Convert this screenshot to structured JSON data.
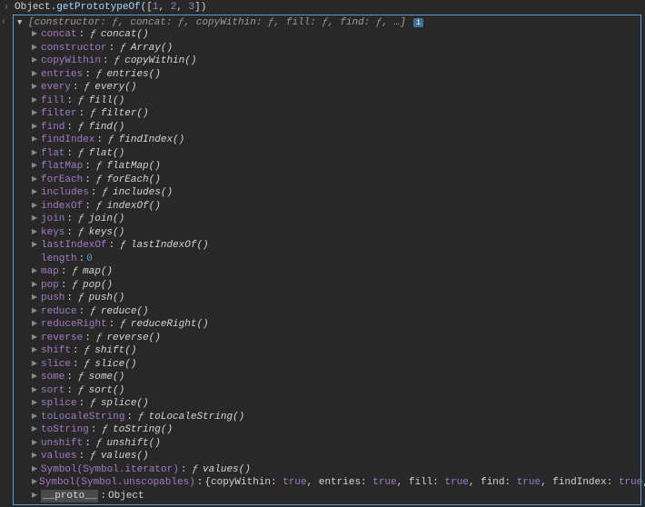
{
  "input": {
    "object": "Object",
    "dot": ".",
    "method": "getPrototypeOf",
    "open": "(",
    "arr_open": "[",
    "n1": "1",
    "comma": ", ",
    "n2": "2",
    "n3": "3",
    "arr_close": "]",
    "close": ")"
  },
  "summary": {
    "text": "[constructor: ƒ, concat: ƒ, copyWithin: ƒ, fill: ƒ, find: ƒ, …]",
    "info": "i"
  },
  "props": [
    {
      "key": "concat",
      "fn": "concat()"
    },
    {
      "key": "constructor",
      "fn": "Array()"
    },
    {
      "key": "copyWithin",
      "fn": "copyWithin()"
    },
    {
      "key": "entries",
      "fn": "entries()"
    },
    {
      "key": "every",
      "fn": "every()"
    },
    {
      "key": "fill",
      "fn": "fill()"
    },
    {
      "key": "filter",
      "fn": "filter()"
    },
    {
      "key": "find",
      "fn": "find()"
    },
    {
      "key": "findIndex",
      "fn": "findIndex()"
    },
    {
      "key": "flat",
      "fn": "flat()"
    },
    {
      "key": "flatMap",
      "fn": "flatMap()"
    },
    {
      "key": "forEach",
      "fn": "forEach()"
    },
    {
      "key": "includes",
      "fn": "includes()"
    },
    {
      "key": "indexOf",
      "fn": "indexOf()"
    },
    {
      "key": "join",
      "fn": "join()"
    },
    {
      "key": "keys",
      "fn": "keys()"
    },
    {
      "key": "lastIndexOf",
      "fn": "lastIndexOf()"
    }
  ],
  "length": {
    "key": "length",
    "val": "0"
  },
  "props2": [
    {
      "key": "map",
      "fn": "map()"
    },
    {
      "key": "pop",
      "fn": "pop()"
    },
    {
      "key": "push",
      "fn": "push()"
    },
    {
      "key": "reduce",
      "fn": "reduce()"
    },
    {
      "key": "reduceRight",
      "fn": "reduceRight()"
    },
    {
      "key": "reverse",
      "fn": "reverse()"
    },
    {
      "key": "shift",
      "fn": "shift()"
    },
    {
      "key": "slice",
      "fn": "slice()"
    },
    {
      "key": "some",
      "fn": "some()"
    },
    {
      "key": "sort",
      "fn": "sort()"
    },
    {
      "key": "splice",
      "fn": "splice()"
    },
    {
      "key": "toLocaleString",
      "fn": "toLocaleString()"
    },
    {
      "key": "toString",
      "fn": "toString()"
    },
    {
      "key": "unshift",
      "fn": "unshift()"
    },
    {
      "key": "values",
      "fn": "values()"
    }
  ],
  "symbol_iterator": {
    "key": "Symbol(Symbol.iterator)",
    "fn": "values()"
  },
  "symbol_unscopables": {
    "key": "Symbol(Symbol.unscopables)",
    "preview": "{copyWithin: true, entries: true, fill: true, find: true, findIndex: true, …}"
  },
  "proto": {
    "key": "__proto__",
    "val": "Object"
  },
  "glyphs": {
    "chev_right_prompt": "›",
    "chev_left_output": "‹",
    "tri_down": "▼",
    "tri_right": "▶",
    "f": "ƒ",
    "colon": ":"
  }
}
